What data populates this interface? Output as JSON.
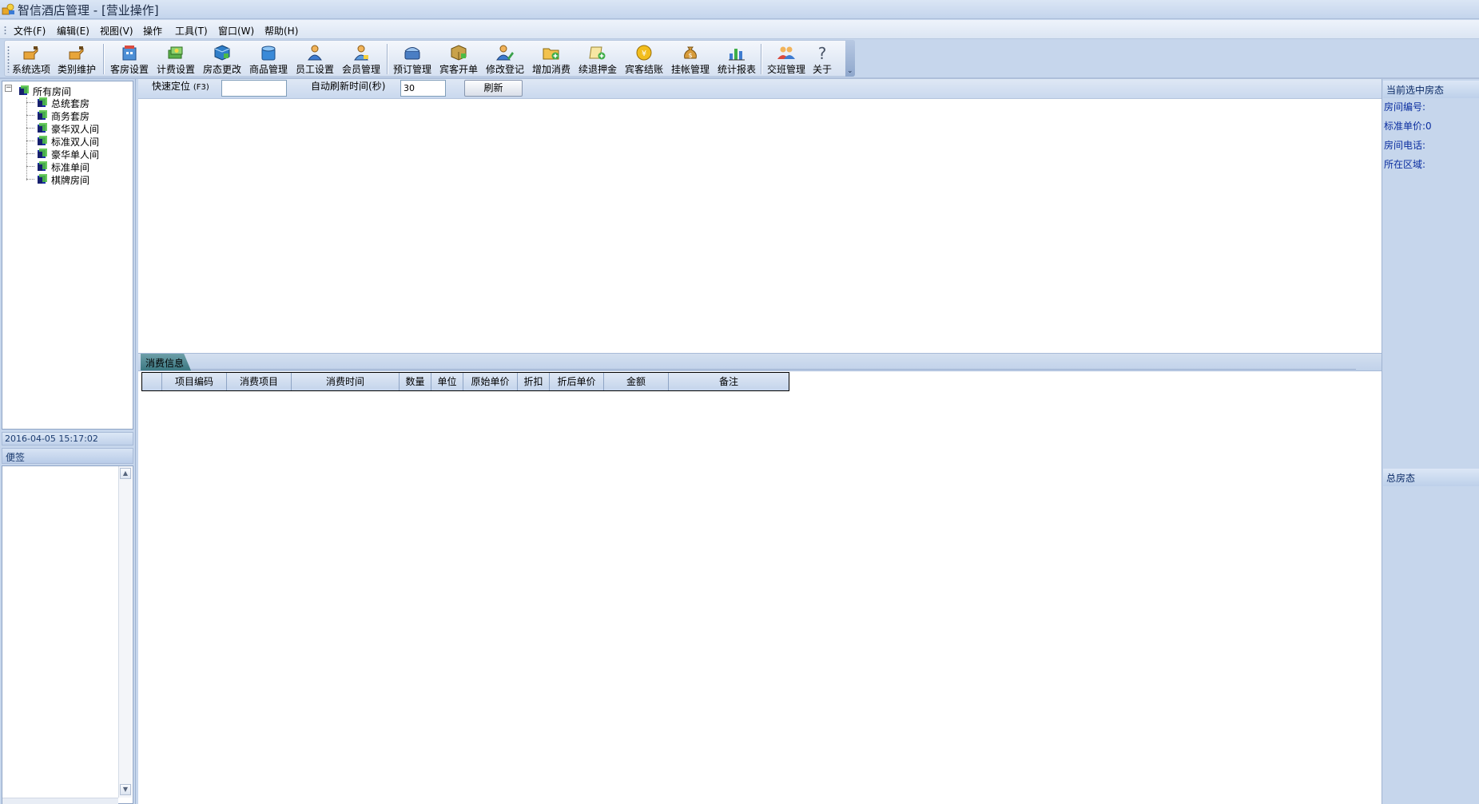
{
  "window": {
    "title": "智信酒店管理 - [营业操作]"
  },
  "menu": {
    "items": [
      {
        "label": "文件(F)"
      },
      {
        "label": "编辑(E)"
      },
      {
        "label": "视图(V)"
      },
      {
        "label": "操作"
      },
      {
        "label": "工具(T)"
      },
      {
        "label": "窗口(W)"
      },
      {
        "label": "帮助(H)"
      }
    ]
  },
  "toolbar": {
    "buttons": [
      {
        "label": "系统选项",
        "icon": "hand-pointer-icon"
      },
      {
        "label": "类别维护",
        "icon": "hand-pointer-icon"
      },
      {
        "label": "客房设置",
        "icon": "building-icon"
      },
      {
        "label": "计费设置",
        "icon": "money-icon"
      },
      {
        "label": "房态更改",
        "icon": "cube-icon"
      },
      {
        "label": "商品管理",
        "icon": "box-icon"
      },
      {
        "label": "员工设置",
        "icon": "person-icon"
      },
      {
        "label": "会员管理",
        "icon": "member-icon"
      },
      {
        "label": "预订管理",
        "icon": "phone-icon"
      },
      {
        "label": "宾客开单",
        "icon": "package-icon"
      },
      {
        "label": "修改登记",
        "icon": "user-edit-icon"
      },
      {
        "label": "增加消费",
        "icon": "folder-add-icon"
      },
      {
        "label": "续退押金",
        "icon": "receipt-icon"
      },
      {
        "label": "宾客结账",
        "icon": "coin-icon"
      },
      {
        "label": "挂帐管理",
        "icon": "moneybag-icon"
      },
      {
        "label": "统计报表",
        "icon": "bar-chart-icon"
      },
      {
        "label": "交班管理",
        "icon": "users-icon"
      },
      {
        "label": "关于",
        "icon": "question-icon"
      }
    ],
    "overflow_glyph": "⌄"
  },
  "tree": {
    "root": "所有房间",
    "children": [
      "总统套房",
      "商务套房",
      "豪华双人间",
      "标准双人间",
      "豪华单人间",
      "标准单间",
      "棋牌房间"
    ],
    "expander_glyph": "−"
  },
  "datetime": "2016-04-05 15:17:02",
  "memo": {
    "title": "便签"
  },
  "filter": {
    "quick_locate_label": "快速定位",
    "quick_locate_hotkey": "(F3)",
    "quick_locate_value": "",
    "refresh_interval_label": "自动刷新时间",
    "refresh_interval_unit": "(秒)",
    "refresh_interval_value": "30",
    "refresh_button": "刷新"
  },
  "consume": {
    "tab_label": "消费信息",
    "columns": [
      "项目编码",
      "消费项目",
      "消费时间",
      "数量",
      "单位",
      "原始单价",
      "折扣",
      "折后单价",
      "金额",
      "备注"
    ],
    "rows": []
  },
  "right_panel": {
    "current_title": "当前选中房态",
    "room_no_label": "房间编号:",
    "price_label": "标准单价:0",
    "phone_label": "房间电话:",
    "area_label": "所在区域:",
    "total_title": "总房态"
  },
  "colors": {
    "panel_bg": "#c6d6ec",
    "info_text": "#0b2ea0",
    "tab_active": "#3b7882"
  }
}
